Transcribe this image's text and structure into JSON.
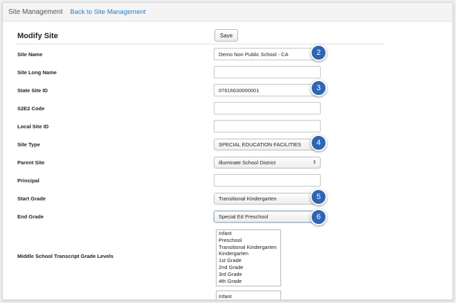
{
  "nav": {
    "title": "Site Management",
    "back_link": "Back to Site Management"
  },
  "form": {
    "heading": "Modify Site",
    "save_label": "Save",
    "fields": {
      "site_name": {
        "label": "Site Name",
        "value": "Demo Non Public School - CA"
      },
      "site_long_name": {
        "label": "Site Long Name",
        "value": ""
      },
      "state_site_id": {
        "label": "State Site ID",
        "value": "07616630000001"
      },
      "s2e2_code": {
        "label": "S2E2 Code",
        "value": ""
      },
      "local_site_id": {
        "label": "Local Site ID",
        "value": ""
      },
      "site_type": {
        "label": "Site Type",
        "value": "SPECIAL EDUCATION FACILITIES"
      },
      "parent_site": {
        "label": "Parent Site",
        "value": "Illuminate School District"
      },
      "principal": {
        "label": "Principal",
        "value": ""
      },
      "start_grade": {
        "label": "Start Grade",
        "value": "Transitional Kindergarten"
      },
      "end_grade": {
        "label": "End Grade",
        "value": "Special Ed Preschool"
      },
      "middle_school_levels": {
        "label": "Middle School Transcript Grade Levels",
        "options": [
          "Infant",
          "Preschool",
          "Transitional Kindergarten",
          "Kindergarten",
          "1st Grade",
          "2nd Grade",
          "3rd Grade",
          "4th Grade"
        ]
      },
      "next_list": {
        "options": [
          "Infant"
        ]
      }
    }
  },
  "badges": [
    "2",
    "3",
    "4",
    "5",
    "6"
  ],
  "icons": {
    "select_arrows": "⇕"
  },
  "colors": {
    "link": "#2a7bc8",
    "badge": "#2f66b3"
  }
}
